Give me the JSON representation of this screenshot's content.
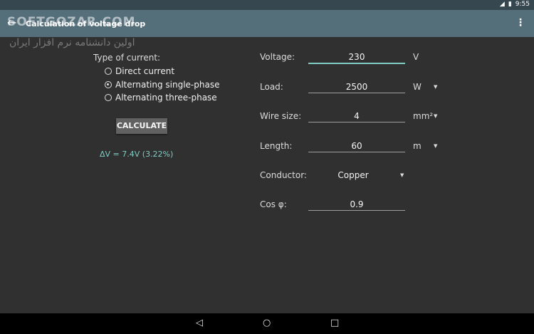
{
  "status": {
    "time": "9:55",
    "signal_icon": "signal-icon",
    "battery_icon": "battery-icon"
  },
  "appbar": {
    "title": "Calculation of voltage drop"
  },
  "watermark": {
    "line1": "SOFTGOZAR.COM",
    "line2": "اولین دانشنامه نرم افزار ایران"
  },
  "current": {
    "label": "Type of current:",
    "options": [
      {
        "label": "Direct current",
        "selected": false
      },
      {
        "label": "Alternating single-phase",
        "selected": true
      },
      {
        "label": "Alternating three-phase",
        "selected": false
      }
    ]
  },
  "calculate_label": "CALCULATE",
  "result": "ΔV = 7.4V  (3.22%)",
  "fields": [
    {
      "label": "Voltage:",
      "value": "230",
      "unit": "V"
    },
    {
      "label": "Load:",
      "value": "2500",
      "unit": "W"
    },
    {
      "label": "Wire size:",
      "value": "4",
      "unit": "mm²"
    },
    {
      "label": "Length:",
      "value": "60",
      "unit": "m"
    },
    {
      "label": "Conductor:",
      "value": "Copper",
      "unit": ""
    },
    {
      "label": "Cos φ:",
      "value": "0.9",
      "unit": ""
    }
  ],
  "colors": {
    "appbar": "#546e7a",
    "accent": "#80cbc4",
    "background": "#303030"
  }
}
